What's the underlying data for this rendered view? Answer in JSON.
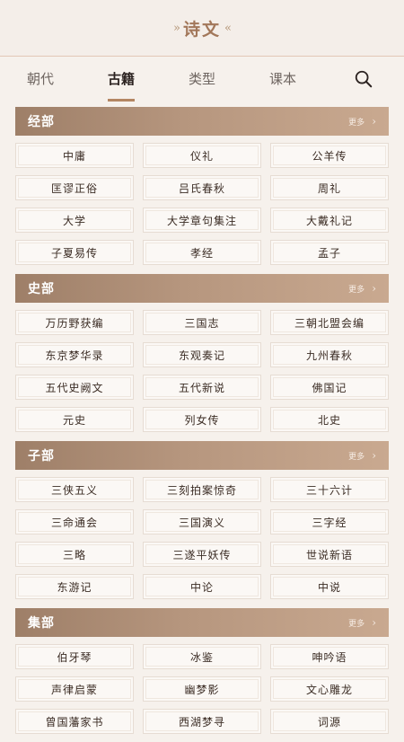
{
  "header": {
    "title": "诗文",
    "left_deco": "»",
    "right_deco": "«"
  },
  "tabs": [
    {
      "label": "朝代"
    },
    {
      "label": "古籍",
      "active": true
    },
    {
      "label": "类型"
    },
    {
      "label": "课本"
    }
  ],
  "search_icon": "search-icon",
  "sections": [
    {
      "name": "经部",
      "more": "更多",
      "items": [
        "中庸",
        "仪礼",
        "公羊传",
        "匡谬正俗",
        "吕氏春秋",
        "周礼",
        "大学",
        "大学章句集注",
        "大戴礼记",
        "子夏易传",
        "孝经",
        "孟子"
      ]
    },
    {
      "name": "史部",
      "more": "更多",
      "items": [
        "万历野获编",
        "三国志",
        "三朝北盟会编",
        "东京梦华录",
        "东观奏记",
        "九州春秋",
        "五代史阙文",
        "五代新说",
        "佛国记",
        "元史",
        "列女传",
        "北史"
      ]
    },
    {
      "name": "子部",
      "more": "更多",
      "items": [
        "三侠五义",
        "三刻拍案惊奇",
        "三十六计",
        "三命通会",
        "三国演义",
        "三字经",
        "三略",
        "三遂平妖传",
        "世说新语",
        "东游记",
        "中论",
        "中说"
      ]
    },
    {
      "name": "集部",
      "more": "更多",
      "items": [
        "伯牙琴",
        "冰鉴",
        "呻吟语",
        "声律启蒙",
        "幽梦影",
        "文心雕龙",
        "曾国藩家书",
        "西湖梦寻",
        "词源"
      ]
    }
  ],
  "colors": {
    "accent": "#b48662",
    "section_bar": "#a88a73",
    "title": "#a2775a"
  }
}
